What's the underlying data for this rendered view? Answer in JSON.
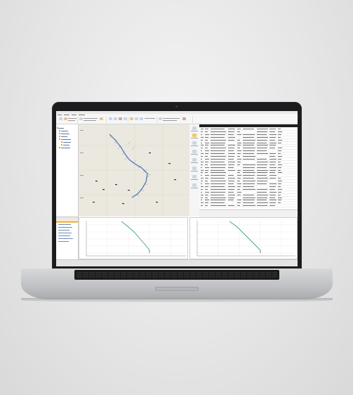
{
  "app": {
    "window_title": "",
    "status_text": ""
  },
  "map": {
    "route_color": "#4a6fb3",
    "background_color": "#ebe8df"
  },
  "table": {
    "header_color": "#1f1f1f",
    "row_count": 29
  },
  "charts": [
    {
      "line_color": "#3aa392"
    },
    {
      "line_color": "#3aa392"
    }
  ]
}
